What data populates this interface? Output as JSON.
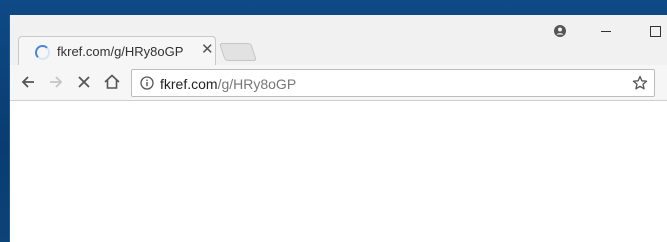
{
  "tab": {
    "title": "fkref.com/g/HRy8oGP",
    "close_symbol": "✕"
  },
  "omnibox": {
    "host": "fkref.com",
    "path": "/g/HRy8oGP"
  },
  "icons": {
    "profile": "person-icon",
    "back": "back-arrow-icon",
    "forward": "forward-arrow-icon",
    "stop": "stop-icon",
    "home": "home-icon",
    "info": "info-icon",
    "star": "star-icon",
    "spinner": "loading-spinner-icon"
  },
  "colors": {
    "accent": "#4a86d6",
    "desktop": "#0b3e74"
  }
}
